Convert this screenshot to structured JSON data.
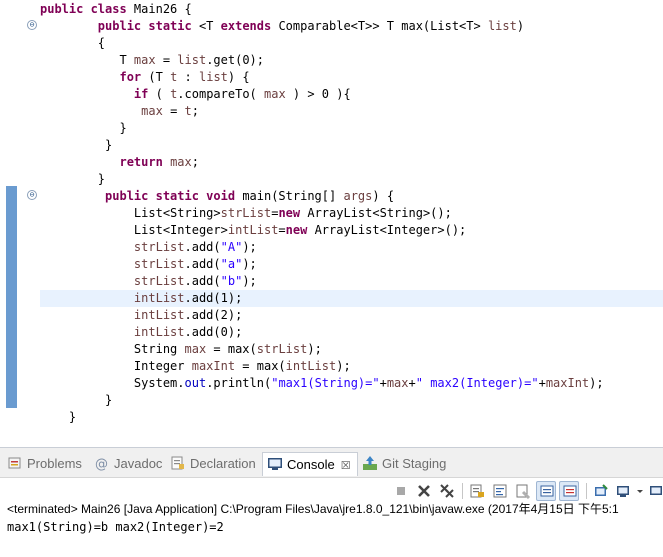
{
  "editor": {
    "fold_markers": [
      "⊖",
      "⊖"
    ],
    "lines": [
      [
        [
          "kw",
          "public class "
        ],
        [
          "plain",
          "Main26 {"
        ]
      ],
      [
        [
          "plain",
          "        "
        ],
        [
          "kw",
          "public static "
        ],
        [
          "plain",
          "<T "
        ],
        [
          "kw",
          "extends "
        ],
        [
          "plain",
          "Comparable<T>> T max(List<T> "
        ],
        [
          "var",
          "list"
        ],
        [
          "plain",
          ")"
        ]
      ],
      [
        [
          "plain",
          "        {"
        ]
      ],
      [
        [
          "plain",
          "           T "
        ],
        [
          "var",
          "max"
        ],
        [
          "plain",
          " = "
        ],
        [
          "var",
          "list"
        ],
        [
          "plain",
          ".get(0);"
        ]
      ],
      [
        [
          "plain",
          "           "
        ],
        [
          "kw",
          "for"
        ],
        [
          "plain",
          " (T "
        ],
        [
          "var",
          "t"
        ],
        [
          "plain",
          " : "
        ],
        [
          "var",
          "list"
        ],
        [
          "plain",
          ") {"
        ]
      ],
      [
        [
          "plain",
          "             "
        ],
        [
          "kw",
          "if"
        ],
        [
          "plain",
          " ( "
        ],
        [
          "var",
          "t"
        ],
        [
          "plain",
          ".compareTo( "
        ],
        [
          "var",
          "max"
        ],
        [
          "plain",
          " ) > 0 ){"
        ]
      ],
      [
        [
          "plain",
          "              "
        ],
        [
          "var",
          "max"
        ],
        [
          "plain",
          " = "
        ],
        [
          "var",
          "t"
        ],
        [
          "plain",
          ";"
        ]
      ],
      [
        [
          "plain",
          "           }"
        ]
      ],
      [
        [
          "plain",
          "         }"
        ]
      ],
      [
        [
          "plain",
          "           "
        ],
        [
          "kw",
          "return "
        ],
        [
          "var",
          "max"
        ],
        [
          "plain",
          ";"
        ]
      ],
      [
        [
          "plain",
          "        }"
        ]
      ],
      [
        [
          "plain",
          "         "
        ],
        [
          "kw",
          "public static void "
        ],
        [
          "plain",
          "main(String[] "
        ],
        [
          "var",
          "args"
        ],
        [
          "plain",
          ") {"
        ]
      ],
      [
        [
          "plain",
          "             List<String>"
        ],
        [
          "var",
          "strList"
        ],
        [
          "plain",
          "="
        ],
        [
          "kw",
          "new "
        ],
        [
          "plain",
          "ArrayList<String>();"
        ]
      ],
      [
        [
          "plain",
          "             List<Integer>"
        ],
        [
          "var",
          "intList"
        ],
        [
          "plain",
          "="
        ],
        [
          "kw",
          "new "
        ],
        [
          "plain",
          "ArrayList<Integer>();"
        ]
      ],
      [
        [
          "plain",
          "             "
        ],
        [
          "var",
          "strList"
        ],
        [
          "plain",
          ".add("
        ],
        [
          "str",
          "\"A\""
        ],
        [
          "plain",
          ");"
        ]
      ],
      [
        [
          "plain",
          "             "
        ],
        [
          "var",
          "strList"
        ],
        [
          "plain",
          ".add("
        ],
        [
          "str",
          "\"a\""
        ],
        [
          "plain",
          ");"
        ]
      ],
      [
        [
          "plain",
          "             "
        ],
        [
          "var",
          "strList"
        ],
        [
          "plain",
          ".add("
        ],
        [
          "str",
          "\"b\""
        ],
        [
          "plain",
          ");"
        ]
      ],
      [
        [
          "plain",
          "             "
        ],
        [
          "var",
          "intList"
        ],
        [
          "plain",
          ".add(1);"
        ]
      ],
      [
        [
          "plain",
          "             "
        ],
        [
          "var",
          "intList"
        ],
        [
          "plain",
          ".add(2);"
        ]
      ],
      [
        [
          "plain",
          "             "
        ],
        [
          "var",
          "intList"
        ],
        [
          "plain",
          ".add(0);"
        ]
      ],
      [
        [
          "plain",
          "             String "
        ],
        [
          "var",
          "max"
        ],
        [
          "plain",
          " = max("
        ],
        [
          "var",
          "strList"
        ],
        [
          "plain",
          ");"
        ]
      ],
      [
        [
          "plain",
          "             Integer "
        ],
        [
          "var",
          "maxInt"
        ],
        [
          "plain",
          " = max("
        ],
        [
          "var",
          "intList"
        ],
        [
          "plain",
          ");"
        ]
      ],
      [
        [
          "plain",
          "             System."
        ],
        [
          "fld",
          "out"
        ],
        [
          "plain",
          ".println("
        ],
        [
          "str",
          "\"max1(String)=\""
        ],
        [
          "plain",
          "+"
        ],
        [
          "var",
          "max"
        ],
        [
          "plain",
          "+"
        ],
        [
          "str",
          "\" max2(Integer)=\""
        ],
        [
          "plain",
          "+"
        ],
        [
          "var",
          "maxInt"
        ],
        [
          "plain",
          ");"
        ]
      ],
      [
        [
          "plain",
          "         }"
        ]
      ],
      [
        [
          "plain",
          "    }"
        ]
      ]
    ]
  },
  "views": {
    "tabs": [
      {
        "label": "Problems",
        "icon": "problems-icon"
      },
      {
        "label": "Javadoc",
        "icon": "at-sign-icon"
      },
      {
        "label": "Declaration",
        "icon": "declaration-icon"
      },
      {
        "label": "Console",
        "icon": "console-icon",
        "active": true,
        "close": "☒"
      },
      {
        "label": "Git Staging",
        "icon": "git-staging-icon"
      }
    ],
    "status": "<terminated> Main26 [Java Application] C:\\Program Files\\Java\\jre1.8.0_121\\bin\\javaw.exe (2017年4月15日 下午5:1",
    "output": "max1(String)=b max2(Integer)=2"
  },
  "colors": {
    "keyword": "#7f0055",
    "string": "#2a00ff",
    "variable": "#6a3e3e",
    "field": "#0000c0",
    "current_line": "#e8f2fe",
    "change_bar": "#6a9bd0"
  }
}
